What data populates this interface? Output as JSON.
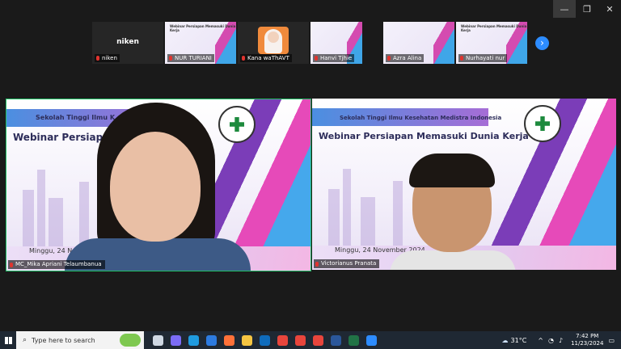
{
  "window_controls": {
    "minimize": "—",
    "restore": "❐",
    "close": "✕"
  },
  "gallery": {
    "tiles": [
      {
        "name": "niken",
        "type": "name-only"
      },
      {
        "name": "NUR TURIANI",
        "type": "slide"
      },
      {
        "name": "Kana waThAVT",
        "type": "avatar"
      },
      {
        "name": "Hanvi Tjhie",
        "type": "slide"
      },
      {
        "name": "Azra Alina",
        "type": "slide"
      },
      {
        "name": "Nurhayati nur",
        "type": "slide"
      }
    ],
    "next_icon": "chevron-right-icon"
  },
  "slide": {
    "institution": "Sekolah Tinggi Ilmu Kesehatan Medistra Indonesia",
    "title": "Webinar Persiapan Memasuki Dunia Kerja",
    "date": "Minggu, 24 November 2024"
  },
  "main_tiles": [
    {
      "participant": "MC_Mika Apriani Telaumbanua",
      "inst_visible": "Sekolah Tinggi Ilmu K",
      "title_visible": "Webinar Persiapan",
      "date_visible": "Minggu, 24 November",
      "active_speaker": true
    },
    {
      "participant": "Victorianus Pranata",
      "inst_visible": "Sekolah Tinggi Ilmu Kesehatan Medistra Indonesia",
      "title_visible": "Webinar Persiapan Memasuki Dunia Kerja",
      "date_visible": "Minggu, 24 November 2024",
      "active_speaker": false
    }
  ],
  "taskbar": {
    "search_placeholder": "Type here to search",
    "weather": "31°C",
    "time": "7:42 PM",
    "date": "11/23/2024",
    "apps": [
      "task-view-icon",
      "copilot-icon",
      "edge-icon",
      "store-icon",
      "firefox-icon",
      "file-explorer-icon",
      "outlook-icon",
      "chrome-icon",
      "chrome-icon",
      "chrome-icon",
      "word-icon",
      "excel-icon",
      "zoom-icon"
    ],
    "app_colors": [
      "#cfd8e3",
      "#7b6cf6",
      "#1f9be0",
      "#2d7be0",
      "#ff7139",
      "#f5c542",
      "#0f6cbd",
      "#e8453c",
      "#e8453c",
      "#e8453c",
      "#2b579a",
      "#217346",
      "#2d8cff"
    ]
  }
}
